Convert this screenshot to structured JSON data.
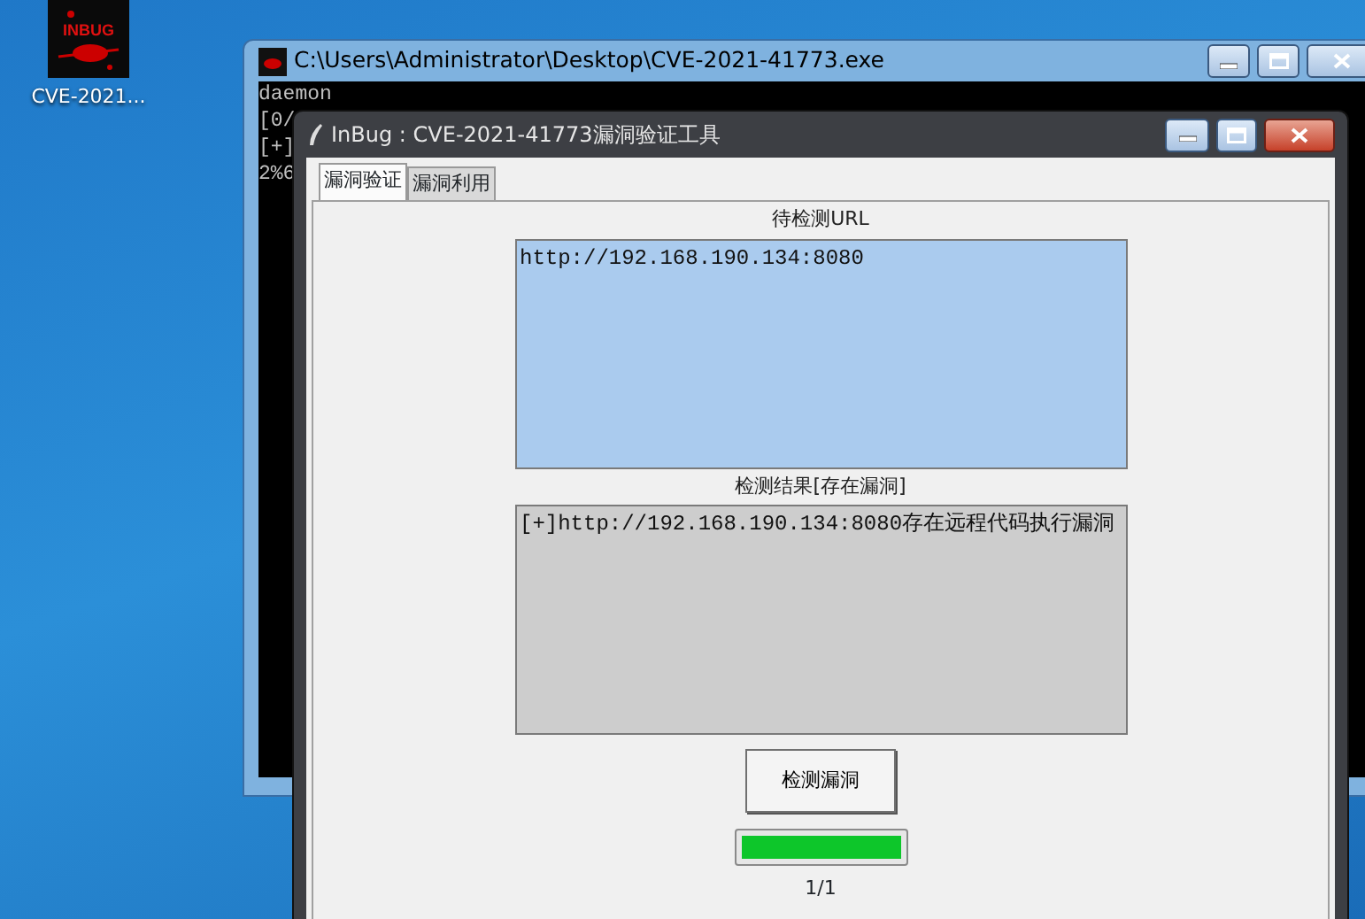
{
  "desktop": {
    "icons": [
      {
        "label": "CVE-2021...",
        "logo_text": "INBUG"
      }
    ]
  },
  "console_window": {
    "title": "C:\\Users\\Administrator\\Desktop\\CVE-2021-41773.exe",
    "lines": [
      "daemon",
      "[0/",
      "[+]",
      "2%6"
    ]
  },
  "tool_window": {
    "title": "InBug : CVE-2021-41773漏洞验证工具",
    "tabs": [
      {
        "label": "漏洞验证",
        "selected": true
      },
      {
        "label": "漏洞利用",
        "selected": false
      }
    ],
    "url_label": "待检测URL",
    "url_value": "http://192.168.190.134:8080",
    "result_label": "检测结果[存在漏洞]",
    "result_value": "[+]http://192.168.190.134:8080存在远程代码执行漏洞",
    "button": "检测漏洞",
    "progress": {
      "level": 1
    },
    "progress_text": "1/1"
  }
}
